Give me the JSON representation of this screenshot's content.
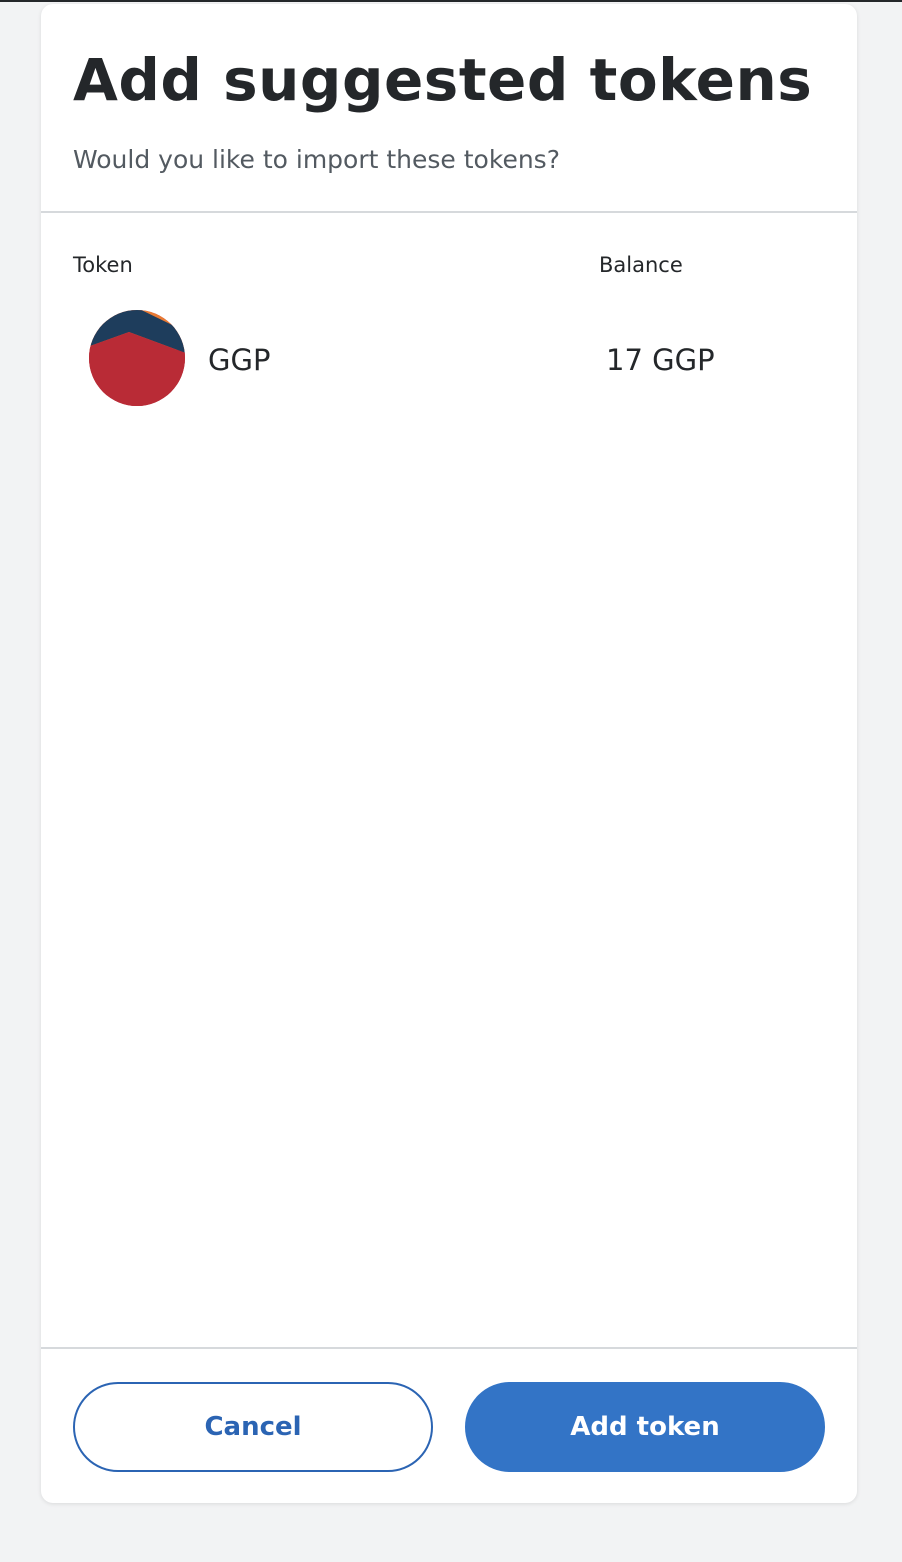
{
  "dialog": {
    "title": "Add suggested tokens",
    "subtitle": "Would you like to import these tokens?"
  },
  "table": {
    "columns": [
      "Token",
      "Balance"
    ],
    "rows": [
      {
        "symbol": "GGP",
        "balance": "17 GGP",
        "icon": "token-jazzicon-avatar"
      }
    ]
  },
  "footer": {
    "cancel_label": "Cancel",
    "add_label": "Add token"
  },
  "colors": {
    "primary": "#3374c6",
    "text": "#24272a",
    "muted": "#535a61",
    "divider": "#d6d9dc",
    "background": "#f2f3f4"
  }
}
